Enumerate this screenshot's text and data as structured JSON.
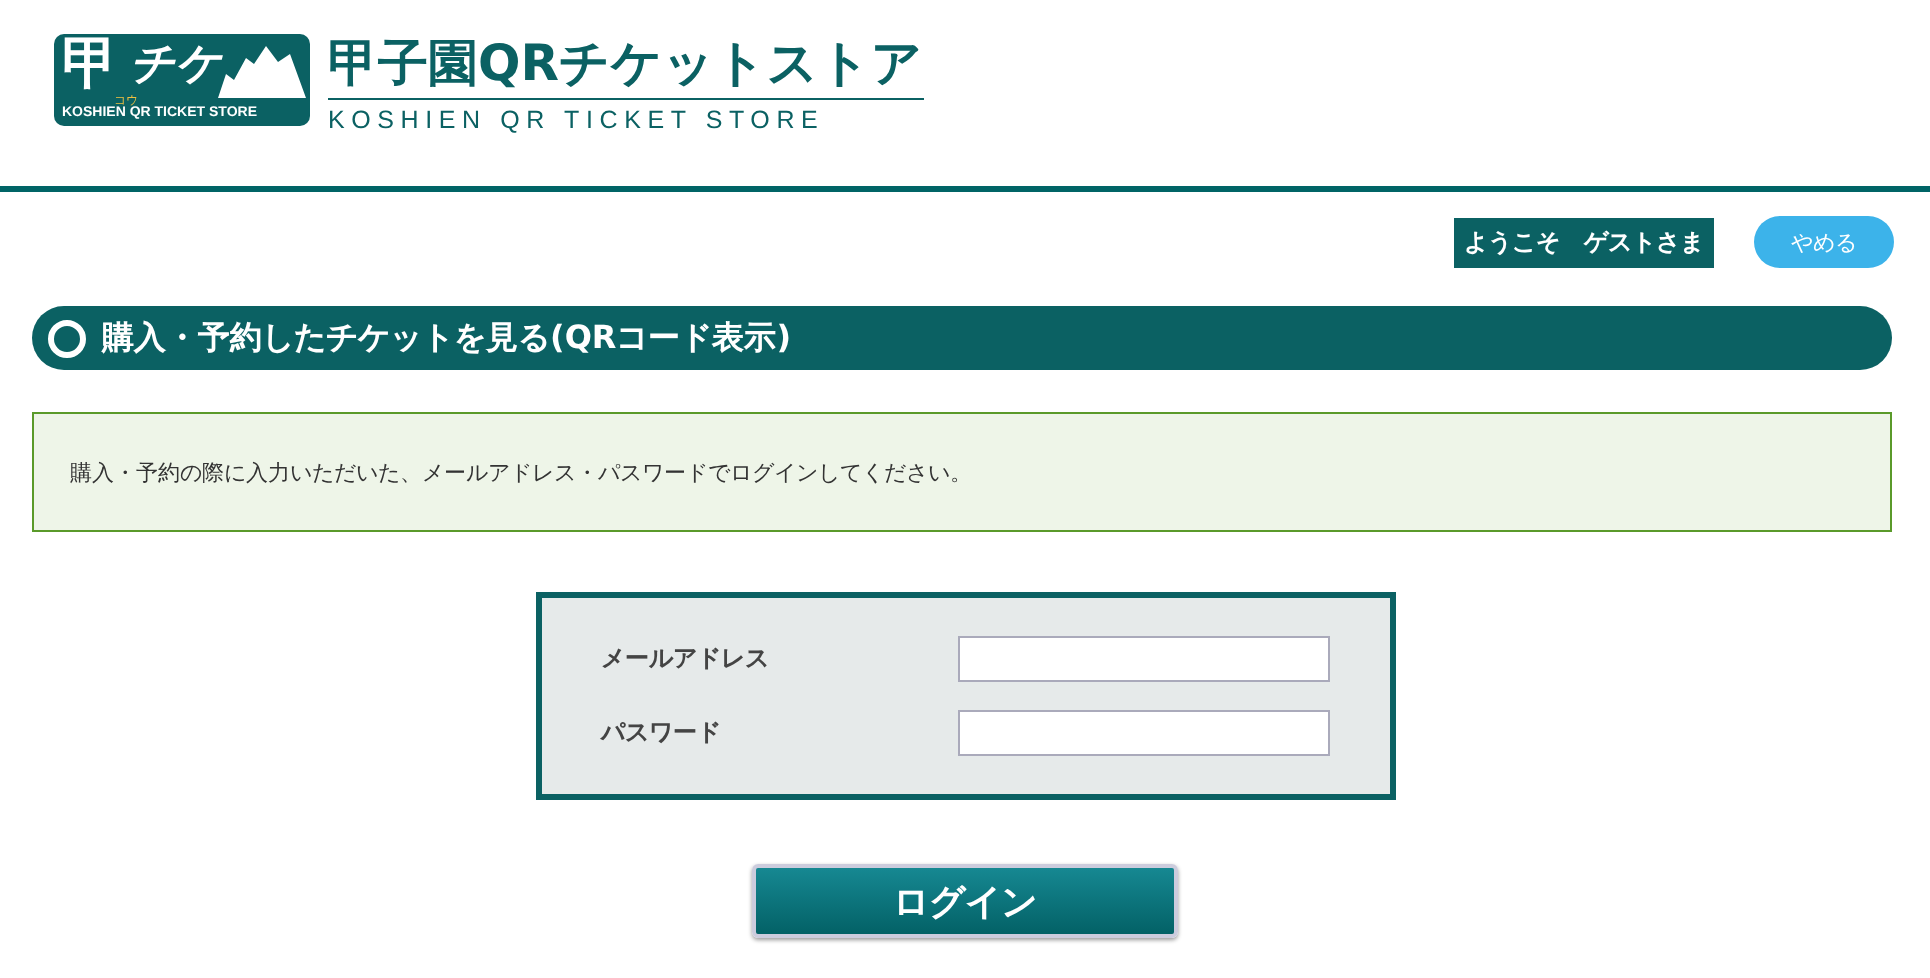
{
  "logo": {
    "mark_main": "甲",
    "mark_ruby": "コウ",
    "mark_kana": "チケ",
    "mark_caption": "KOSHIEN QR TICKET STORE",
    "title": "甲子園QRチケットストア",
    "subtitle": "KOSHIEN QR TICKET STORE"
  },
  "user_bar": {
    "greeting": "ようこそ　ゲストさま",
    "quit_button": "やめる"
  },
  "section_title": "購入・予約したチケットを見る(QRコード表示)",
  "notice": "購入・予約の際に入力いただいた、メールアドレス・パスワードでログインしてください。",
  "form": {
    "fields": [
      {
        "label": "メールアドレス"
      },
      {
        "label": "パスワード"
      }
    ],
    "login_button": "ログイン"
  }
}
